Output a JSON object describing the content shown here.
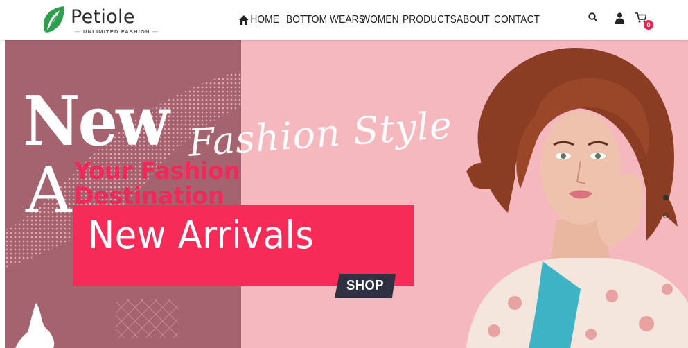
{
  "brand": {
    "name": "Petiole",
    "tagline": "UNLIMITED FASHION",
    "colors": {
      "leaf": "#2e9e4f",
      "accent": "#f72b58",
      "dark": "#2f3142",
      "panel": "#a5636f",
      "hero_bg": "#f5b8bf"
    }
  },
  "nav": {
    "items": [
      {
        "label": "HOME",
        "icon": "home-icon"
      },
      {
        "label": "BOTTOM WEARS"
      },
      {
        "label": "WOMEN"
      },
      {
        "label": "PRODUCTS"
      },
      {
        "label": "ABOUT"
      },
      {
        "label": "CONTACT"
      }
    ]
  },
  "header_icons": {
    "search": "search-icon",
    "user": "user-icon",
    "cart": "cart-icon"
  },
  "cart": {
    "count": "0"
  },
  "hero": {
    "big_word": "New",
    "big_letter": "A",
    "script": "Fashion Style",
    "headline": "Your Fashion Destination",
    "banner": "New Arrivals",
    "cta": "SHOP",
    "slides": {
      "count": 2,
      "active": 0
    }
  }
}
